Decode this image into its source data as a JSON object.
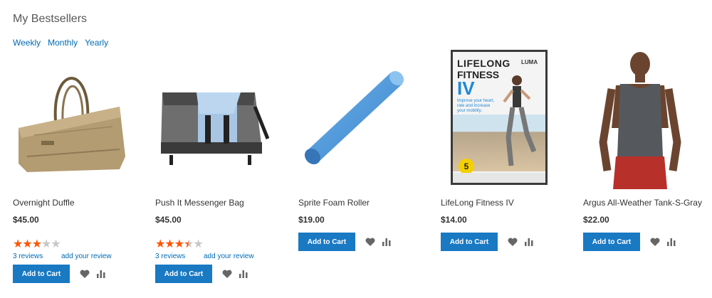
{
  "widget": {
    "title": "My Bestsellers"
  },
  "periods": [
    {
      "label": "Weekly"
    },
    {
      "label": "Monthly"
    },
    {
      "label": "Yearly"
    }
  ],
  "colors": {
    "link": "#006bb4",
    "button": "#1979c3",
    "star_on": "#ff5501",
    "star_off": "#c7c7c7"
  },
  "products": [
    {
      "name": "Overnight Duffle",
      "price": "$45.00",
      "rating": 3,
      "reviews": "3  reviews",
      "add_review": "add your review",
      "add_to_cart": "Add to Cart",
      "image": "duffle-bag"
    },
    {
      "name": "Push It Messenger Bag",
      "price": "$45.00",
      "rating": 3.5,
      "reviews": "3  reviews",
      "add_review": "add your review",
      "add_to_cart": "Add to Cart",
      "image": "messenger-bag"
    },
    {
      "name": "Sprite Foam Roller",
      "price": "$19.00",
      "add_to_cart": "Add to Cart",
      "image": "foam-roller"
    },
    {
      "name": "LifeLong Fitness IV",
      "price": "$14.00",
      "add_to_cart": "Add to Cart",
      "image": "dvd-case",
      "dvd": {
        "line1": "LIFELONG",
        "line2": "FITNESS",
        "line3": "IV",
        "brand": "LUMA",
        "badge": "5",
        "tagline": "Improve your heart, rate and increase your mobility."
      }
    },
    {
      "name": "Argus All-Weather Tank-S-Gray",
      "price": "$22.00",
      "add_to_cart": "Add to Cart",
      "image": "gray-tank-model"
    }
  ]
}
